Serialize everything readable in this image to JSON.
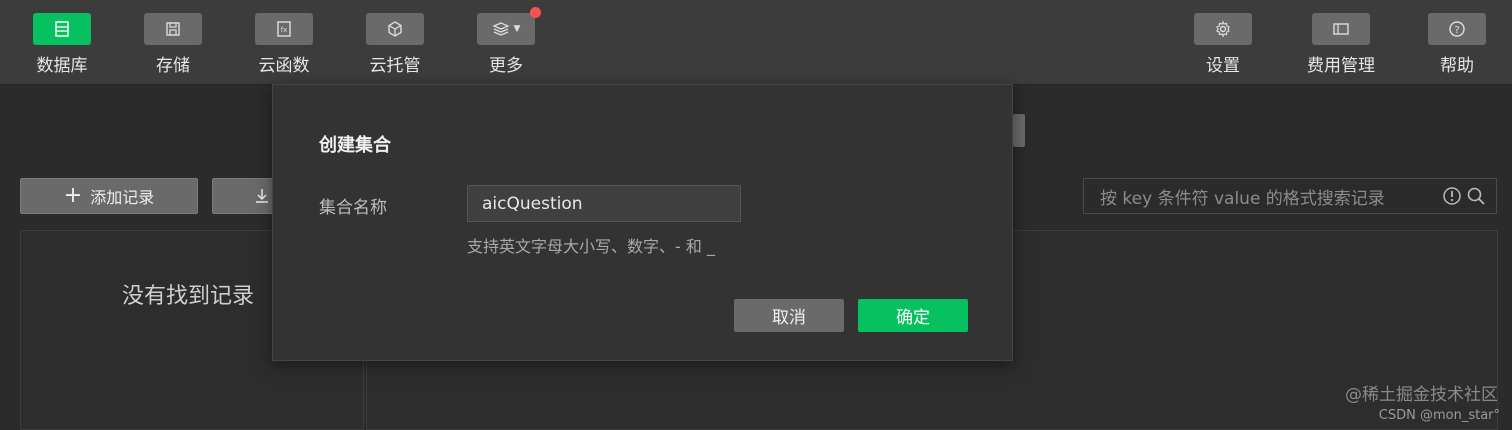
{
  "toolbar": {
    "left": [
      {
        "label": "数据库",
        "icon": "database-icon",
        "active": true
      },
      {
        "label": "存储",
        "icon": "save-icon"
      },
      {
        "label": "云函数",
        "icon": "function-icon"
      },
      {
        "label": "云托管",
        "icon": "cube-icon"
      },
      {
        "label": "更多",
        "icon": "layers-icon"
      }
    ],
    "right": [
      {
        "label": "设置",
        "icon": "gear-icon"
      },
      {
        "label": "费用管理",
        "icon": "billing-icon"
      },
      {
        "label": "帮助",
        "icon": "help-icon"
      }
    ]
  },
  "content": {
    "add_record_label": "添加记录",
    "empty_text": "没有找到记录",
    "search_placeholder": "按 key 条件符 value 的格式搜索记录"
  },
  "modal": {
    "title": "创建集合",
    "field_label": "集合名称",
    "field_value": "aicQuestion",
    "hint": "支持英文字母大小写、数字、- 和 _",
    "cancel_label": "取消",
    "confirm_label": "确定"
  },
  "watermark": {
    "line1": "@稀土掘金技术社区",
    "line2": "CSDN @mon_star°"
  },
  "colors": {
    "accent": "#07c160",
    "toolbar_bg": "#3c3c3c",
    "button_gray": "#6a6a6a",
    "badge_red": "#fa5151"
  }
}
